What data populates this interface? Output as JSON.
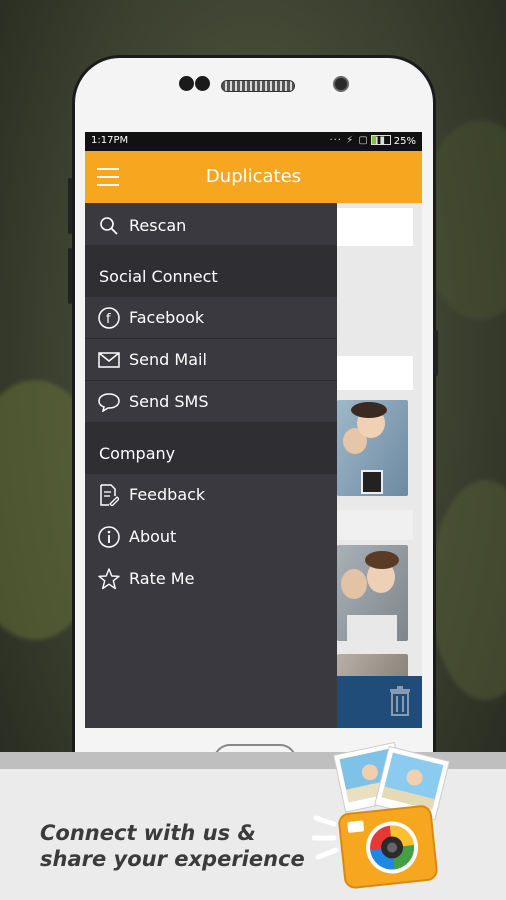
{
  "status_bar": {
    "time": "1:17PM",
    "icons": "··· ⚡ ▢ ▮▮",
    "battery": "25%"
  },
  "app_bar": {
    "title": "Duplicates",
    "menu_icon": "hamburger-icon"
  },
  "drawer": {
    "rescan": {
      "label": "Rescan",
      "icon": "search-icon"
    },
    "social_connect": {
      "header": "Social Connect",
      "items": [
        {
          "label": "Facebook",
          "icon": "facebook-icon"
        },
        {
          "label": "Send Mail",
          "icon": "mail-icon"
        },
        {
          "label": "Send SMS",
          "icon": "chat-bubble-icon"
        }
      ]
    },
    "company": {
      "header": "Company",
      "items": [
        {
          "label": "Feedback",
          "icon": "feedback-icon"
        },
        {
          "label": "About",
          "icon": "info-icon"
        },
        {
          "label": "Rate Me",
          "icon": "star-icon"
        }
      ]
    }
  },
  "underlying": {
    "delete_icon": "trash-icon"
  },
  "promo": {
    "line1": "Connect with us &",
    "line2": "share your experience"
  },
  "colors": {
    "accent": "#f6a71f",
    "drawer_bg": "#3a3940",
    "drawer_header_bg": "#2f2e33",
    "bottom_bar": "#1f4c78"
  }
}
